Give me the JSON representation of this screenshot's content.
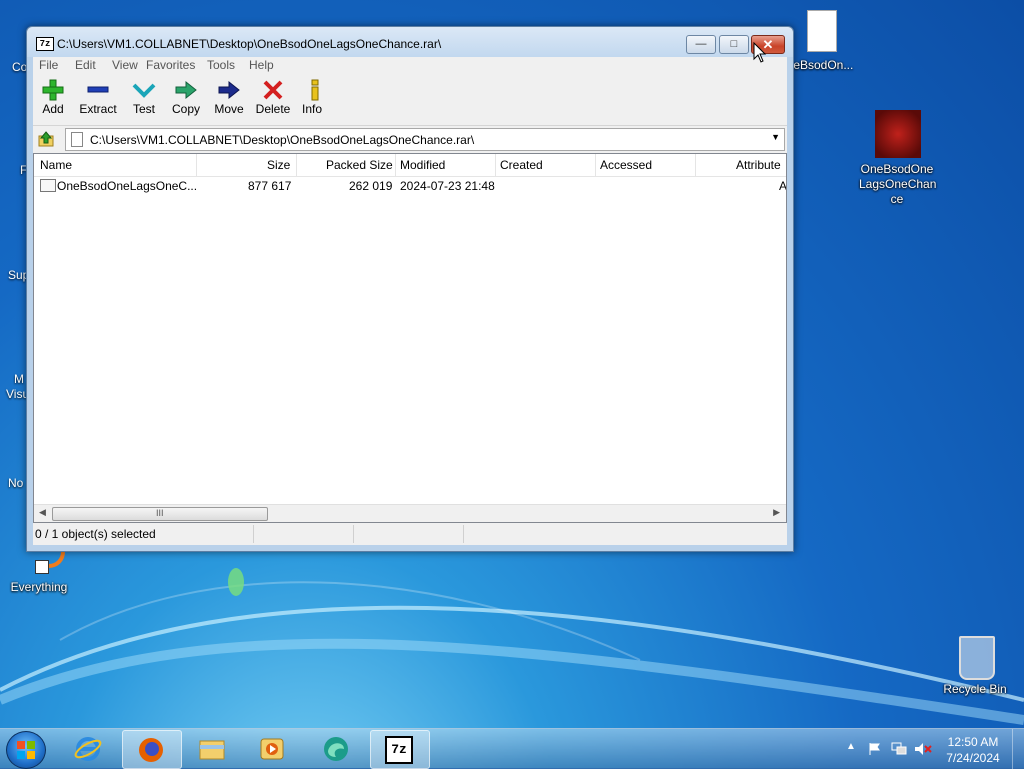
{
  "window": {
    "title": "C:\\Users\\VM1.COLLABNET\\Desktop\\OneBsodOneLagsOneChance.rar\\",
    "app_icon_text": "7z",
    "controls": {
      "minimize": "—",
      "maximize": "□",
      "close": "✕"
    }
  },
  "menu": [
    "File",
    "Edit",
    "View",
    "Favorites",
    "Tools",
    "Help"
  ],
  "toolbar": {
    "add": "Add",
    "extract": "Extract",
    "test": "Test",
    "copy": "Copy",
    "move": "Move",
    "delete": "Delete",
    "info": "Info"
  },
  "address": {
    "path": "C:\\Users\\VM1.COLLABNET\\Desktop\\OneBsodOneLagsOneChance.rar\\"
  },
  "columns": [
    "Name",
    "Size",
    "Packed Size",
    "Modified",
    "Created",
    "Accessed",
    "Attribute"
  ],
  "files": [
    {
      "name": "OneBsodOneLagsOneC...",
      "size": "877 617",
      "packed": "262 019",
      "modified": "2024-07-23 21:48",
      "created": "",
      "accessed": "",
      "attr": "A"
    }
  ],
  "scrollbar": {
    "grip": "III"
  },
  "status": {
    "selection": "0 / 1 object(s) selected"
  },
  "desktop": {
    "file_icon_label": "neBsodOn...",
    "exe_icon_label": "OneBsodOne LagsOneChan ce",
    "everything_label": "Everything",
    "recycle_bin_label": "Recycle Bin",
    "left_cut_labels": [
      "Co",
      "F",
      "Sup",
      "M",
      "Visu",
      "No"
    ]
  },
  "taskbar": {
    "apps": [
      "internet-explorer",
      "firefox",
      "file-explorer",
      "media-player",
      "edge-like",
      "7-zip"
    ],
    "app_7z_label": "7z",
    "clock_time": "12:50 AM",
    "clock_date": "7/24/2024"
  }
}
